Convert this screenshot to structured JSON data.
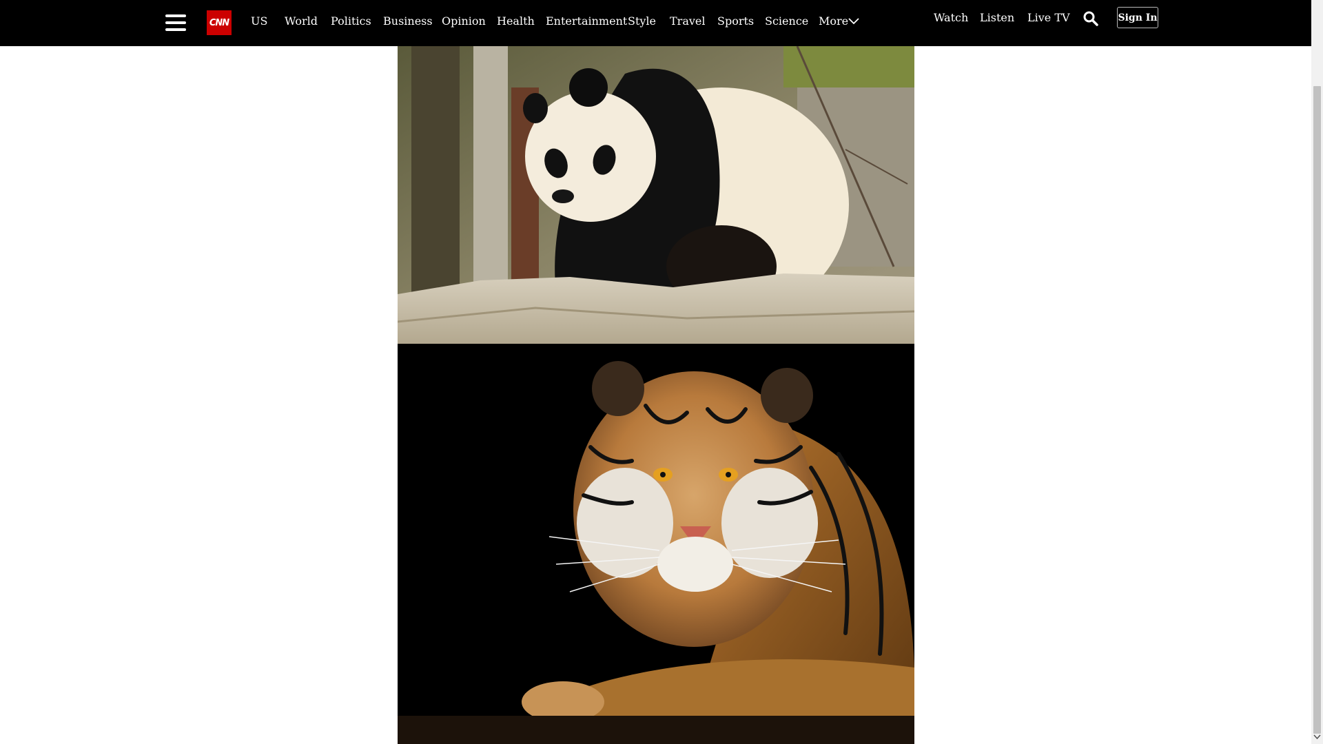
{
  "header": {
    "logo_text": "CNN",
    "nav": [
      {
        "label": "US"
      },
      {
        "label": "World"
      },
      {
        "label": "Politics"
      },
      {
        "label": "Business"
      },
      {
        "label": "Opinion"
      },
      {
        "label": "Health"
      },
      {
        "label": "Entertainment"
      },
      {
        "label": "Style"
      },
      {
        "label": "Travel"
      },
      {
        "label": "Sports"
      },
      {
        "label": "Science"
      },
      {
        "label": "More"
      }
    ],
    "utility": {
      "watch": "Watch",
      "listen": "Listen",
      "live_tv": "Live TV",
      "sign_in": "Sign In"
    },
    "icons": [
      "menu-icon",
      "chevron-down-icon",
      "search-icon"
    ]
  },
  "photos": [
    {
      "subject": "panda-photo"
    },
    {
      "subject": "tiger-photo"
    }
  ],
  "colors": {
    "topbar_bg": "#000000",
    "logo_red": "#cc0000",
    "page_bg": "#ffffff"
  }
}
